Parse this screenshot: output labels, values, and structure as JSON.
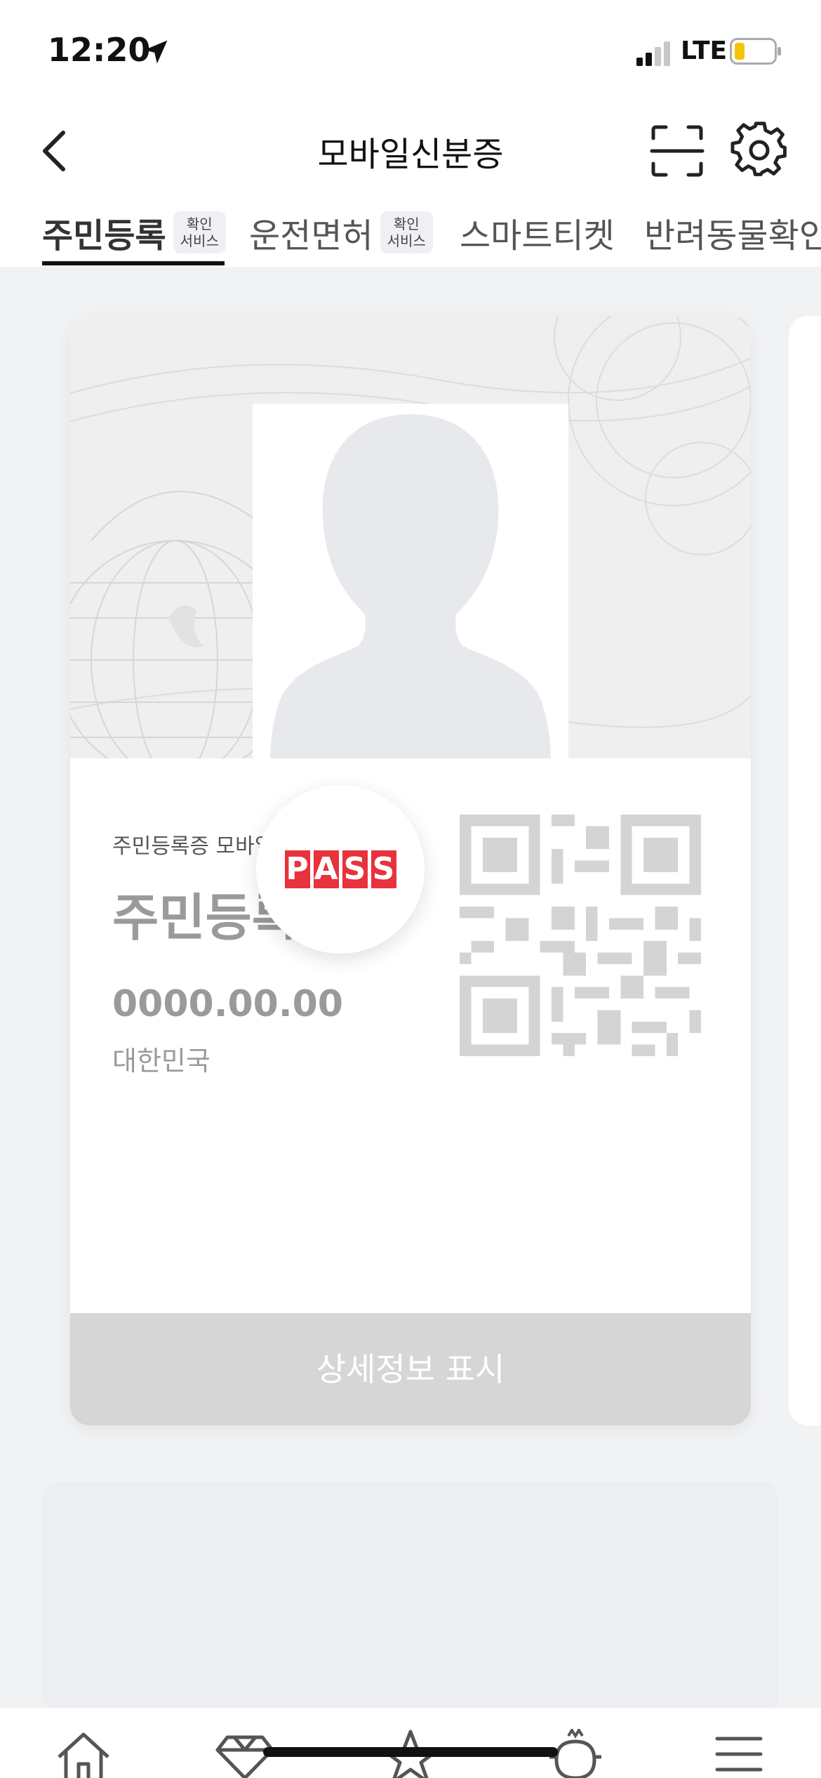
{
  "status": {
    "time": "12:20",
    "network": "LTE"
  },
  "header": {
    "title": "모바일신분증"
  },
  "tabs": [
    {
      "label": "주민등록",
      "badge_line1": "확인",
      "badge_line2": "서비스"
    },
    {
      "label": "운전면허",
      "badge_line1": "확인",
      "badge_line2": "서비스"
    },
    {
      "label": "스마트티켓"
    },
    {
      "label": "반려동물확인"
    }
  ],
  "card": {
    "subtitle": "주민등록증 모바일 확인",
    "title": "주민등록증",
    "date": "0000.00.00",
    "country": "대한민국",
    "logo": [
      "P",
      "A",
      "S",
      "S"
    ],
    "detail_button": "상세정보 표시"
  },
  "colors": {
    "accent": "#e8323c",
    "muted": "#9a9a9a",
    "button": "#d6d6d6"
  }
}
